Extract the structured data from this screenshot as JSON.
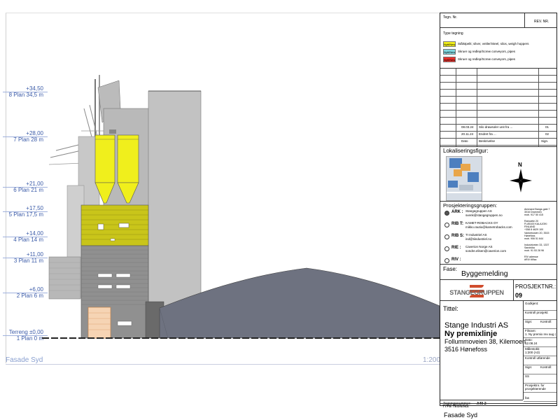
{
  "drawing": {
    "view_label": "Fasade Syd",
    "scale_label": "1:200",
    "levels": [
      {
        "value": "+34,50",
        "name": "8 Plan 34,5 m"
      },
      {
        "value": "+28,00",
        "name": "7 Plan 28 m"
      },
      {
        "value": "+21,00",
        "name": "6 Plan 21 m"
      },
      {
        "value": "+17,50",
        "name": "5 Plan 17,5 m"
      },
      {
        "value": "+14,00",
        "name": "4 Plan 14 m"
      },
      {
        "value": "+11,00",
        "name": "3 Plan 11 m"
      },
      {
        "value": "+6,00",
        "name": "2 Plan 6 m"
      },
      {
        "value": "Terreng   ±0,00",
        "name": "1 Plan 0 m"
      }
    ],
    "colors": {
      "yellow": "#f0ef1c",
      "olive": "#c9c51a",
      "roof": "#6e7280",
      "level": "#3b5ba8"
    }
  },
  "titleblock": {
    "tegn_nr_label": "Tegn. Nr.",
    "rev_nr_label": "REV. NR.",
    "type_tegning_label": "Type tegning",
    "legend": [
      {
        "tag": "Nytt/New",
        "text": "Stålstpelit; silver, veitler/Steel, silos, weigh hoppers",
        "color": "#f2ef1c"
      },
      {
        "tag": "Nytt/New",
        "text": "Skruer og redlep/Screw conveyors, pipes",
        "color": "#7fd7e0"
      },
      {
        "tag": "Nytt/New",
        "text": "Skruer og redlep/Screw conveyors, pipes",
        "color": "#e8302a"
      }
    ],
    "revisions": [
      {
        "date": "08.03.24",
        "text": "Silo drawsoler unit fra ...",
        "rev": "01"
      },
      {
        "date": "20.11.24",
        "text": "Endret fra ...",
        "rev": "02"
      }
    ],
    "rev_headers": {
      "dato": "Dato",
      "beskrivelse": "Beskrivelse",
      "sign": "Sign."
    },
    "lokal_label": "Lokaliseringsfigur:",
    "north": "N",
    "prosj_label": "Prosjekteringsgruppen:",
    "team": [
      {
        "role": "ARK :",
        "company": "Stangegruppen AS",
        "email": "svenk@stangegruppen.no",
        "addr": "Ammand Bangs gate 7\n3016 Drammen\nmob. 917 50 415"
      },
      {
        "role": "RIB T:",
        "company": "KAMET-ROBACKS OY",
        "email": "mikko.rautio@kametrobacks.com",
        "addr": "Rahovitie 20\nFI-85100 KALAJOKI\nFINLAND\n+358 8 4629 100"
      },
      {
        "role": "RIB S:",
        "company": "TI Industriel AS",
        "email": "ind@tiindustriel.no",
        "addr": "Vankebosien 20, 3515\nHønefoss\nmob. 906 51 644"
      },
      {
        "role": "RIE :",
        "company": "Caverion Norge AS",
        "email": "sondre.elisen@caverion.com",
        "addr": "Industriveien 33, 1337\nSandvika\nmob. 91 53 28 96"
      },
      {
        "role": "RIV :",
        "company": "",
        "email": "",
        "addr": "RIV adresse\n#RIV tlf/fax"
      }
    ],
    "fase_label": "Fase:",
    "fase_value": "Byggemelding",
    "logo_text": "STANGEGRUPPEN",
    "prosjektnr_label": "PROSJEKTNR.:",
    "prosjektnr_value": "09",
    "tittel_label": "Tittel:",
    "title_line1": "Stange Industri AS",
    "title_line2": "Ny premixlinje",
    "address1": "Follummoveien 38, Kilemoen",
    "address2": "3516 Hønefoss",
    "side": [
      {
        "label": "Godkjent:",
        "value": ""
      },
      {
        "label": "Kontroll prosjekt:",
        "value": ""
      },
      {
        "label": "Sign:",
        "value": "Kontroll:"
      },
      {
        "label": "Filnavn:",
        "value": "1. Ny premix rev aug 24.pln"
      },
      {
        "label": "Dato:",
        "value": "12.08.24"
      },
      {
        "label": "Målestokk:",
        "value": "1:200 (A3)"
      },
      {
        "label": "Kontroll utførende",
        "value": ""
      },
      {
        "label": "Sign:",
        "value": "Kontroll:"
      },
      {
        "label": "SS",
        "value": ""
      },
      {
        "label": "Prosjektnr. for",
        "value": "prosjekterende"
      },
      {
        "label": "",
        "value": "fas"
      }
    ],
    "tegningsnummer_label": "Tegningsnummer:",
    "tegningsnummer_value": "A40-2",
    "type_tegning2_label": "TYPE TEGNING:",
    "type_tegning2_value": "Fasade Syd"
  }
}
